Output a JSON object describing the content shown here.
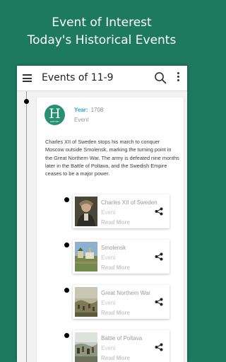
{
  "promo": {
    "line1": "Event of Interest",
    "line2": "Today's Historical Events"
  },
  "appbar": {
    "menu_icon": "hamburger-menu-icon",
    "title": "Events of 11-9",
    "search_icon": "search-icon",
    "more_icon": "more-vertical-icon"
  },
  "event": {
    "logo_letter": "H",
    "logo_caption": "HISTORY",
    "year_label": "Year:",
    "year": "1708",
    "type": "Event",
    "description": "Charles XII of Sweden stops his march to conquer Moscow outside Smolensk, marking the turning point in the Great Northern War. The army is defeated nine months later in the Battle of Poltava, and the Swedish Empire ceases to be a major power."
  },
  "related": [
    {
      "name": "Charles XII of Sweden",
      "type": "Event",
      "more": "Read More",
      "thumb": "portrait-painting"
    },
    {
      "name": "Smolensk",
      "type": "Event",
      "more": "Read More",
      "thumb": "city-photo"
    },
    {
      "name": "Great Northern War",
      "type": "Event",
      "more": "Read More",
      "thumb": "battle-painting"
    },
    {
      "name": "Battle of Poltava",
      "type": "Event",
      "more": "Read More",
      "thumb": "battle-painting"
    }
  ],
  "colors": {
    "background": "#1d7a5f",
    "logo": "#26906f",
    "year_label": "#2aa3e0"
  }
}
